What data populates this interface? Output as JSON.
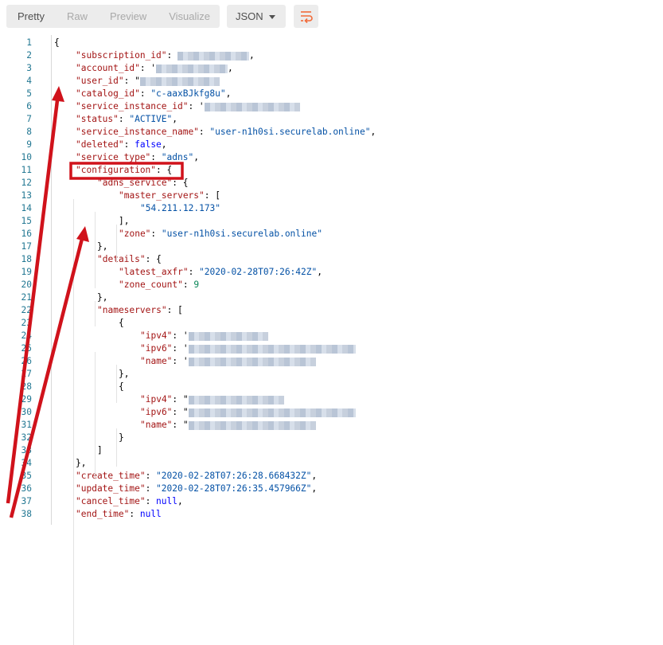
{
  "toolbar": {
    "tabs": [
      "Pretty",
      "Raw",
      "Preview",
      "Visualize"
    ],
    "format": "JSON",
    "wrap_icon": "wrap-lines-icon"
  },
  "code": {
    "lines": [
      [
        [
          "p",
          "{"
        ]
      ],
      [
        [
          "k",
          "\"subscription_id\""
        ],
        [
          "p",
          ": "
        ],
        [
          "R",
          ""
        ],
        [
          "p",
          ","
        ]
      ],
      [
        [
          "k",
          "\"account_id\""
        ],
        [
          "p",
          ": '"
        ],
        [
          "R",
          ""
        ],
        [
          "p",
          ","
        ]
      ],
      [
        [
          "k",
          "\"user_id\""
        ],
        [
          "p",
          ": \""
        ],
        [
          "R",
          ""
        ]
      ],
      [
        [
          "k",
          "\"catalog_id\""
        ],
        [
          "p",
          ": "
        ],
        [
          "s",
          "\"c-aaxBJkfg8u\""
        ],
        [
          "p",
          ","
        ]
      ],
      [
        [
          "k",
          "\"service_instance_id\""
        ],
        [
          "p",
          ": '"
        ],
        [
          "R",
          ""
        ]
      ],
      [
        [
          "k",
          "\"status\""
        ],
        [
          "p",
          ": "
        ],
        [
          "s",
          "\"ACTIVE\""
        ],
        [
          "p",
          ","
        ]
      ],
      [
        [
          "k",
          "\"service_instance_name\""
        ],
        [
          "p",
          ": "
        ],
        [
          "s",
          "\"user-n1h0si.securelab.online\""
        ],
        [
          "p",
          ","
        ]
      ],
      [
        [
          "k",
          "\"deleted\""
        ],
        [
          "p",
          ": "
        ],
        [
          "b",
          "false"
        ],
        [
          "p",
          ","
        ]
      ],
      [
        [
          "k",
          "\"service_type\""
        ],
        [
          "p",
          ": "
        ],
        [
          "s",
          "\"adns\""
        ],
        [
          "p",
          ","
        ]
      ],
      [
        [
          "k",
          "\"configuration\""
        ],
        [
          "p",
          ": {"
        ]
      ],
      [
        [
          "k",
          "\"adns_service\""
        ],
        [
          "p",
          ": {"
        ]
      ],
      [
        [
          "k",
          "\"master_servers\""
        ],
        [
          "p",
          ": ["
        ]
      ],
      [
        [
          "s",
          "\"54.211.12.173\""
        ]
      ],
      [
        [
          "p",
          "],"
        ]
      ],
      [
        [
          "k",
          "\"zone\""
        ],
        [
          "p",
          ": "
        ],
        [
          "s",
          "\"user-n1h0si.securelab.online\""
        ]
      ],
      [
        [
          "p",
          "},"
        ]
      ],
      [
        [
          "k",
          "\"details\""
        ],
        [
          "p",
          ": {"
        ]
      ],
      [
        [
          "k",
          "\"latest_axfr\""
        ],
        [
          "p",
          ": "
        ],
        [
          "s",
          "\"2020-02-28T07:26:42Z\""
        ],
        [
          "p",
          ","
        ]
      ],
      [
        [
          "k",
          "\"zone_count\""
        ],
        [
          "p",
          ": "
        ],
        [
          "n",
          "9"
        ]
      ],
      [
        [
          "p",
          "},"
        ]
      ],
      [
        [
          "k",
          "\"nameservers\""
        ],
        [
          "p",
          ": ["
        ]
      ],
      [
        [
          "p",
          "{"
        ]
      ],
      [
        [
          "k",
          "\"ipv4\""
        ],
        [
          "p",
          ": '"
        ],
        [
          "R",
          ""
        ]
      ],
      [
        [
          "k",
          "\"ipv6\""
        ],
        [
          "p",
          ": '"
        ],
        [
          "R",
          ""
        ]
      ],
      [
        [
          "k",
          "\"name\""
        ],
        [
          "p",
          ": '"
        ],
        [
          "R",
          ""
        ]
      ],
      [
        [
          "p",
          "},"
        ]
      ],
      [
        [
          "p",
          "{"
        ]
      ],
      [
        [
          "k",
          "\"ipv4\""
        ],
        [
          "p",
          ": \""
        ],
        [
          "R",
          ""
        ]
      ],
      [
        [
          "k",
          "\"ipv6\""
        ],
        [
          "p",
          ": \""
        ],
        [
          "R",
          ""
        ]
      ],
      [
        [
          "k",
          "\"name\""
        ],
        [
          "p",
          ": \""
        ],
        [
          "R",
          ""
        ]
      ],
      [
        [
          "p",
          "}"
        ]
      ],
      [
        [
          "p",
          "]"
        ]
      ],
      [
        [
          "p",
          "},"
        ]
      ],
      [
        [
          "k",
          "\"create_time\""
        ],
        [
          "p",
          ": "
        ],
        [
          "s",
          "\"2020-02-28T07:26:28.668432Z\""
        ],
        [
          "p",
          ","
        ]
      ],
      [
        [
          "k",
          "\"update_time\""
        ],
        [
          "p",
          ": "
        ],
        [
          "s",
          "\"2020-02-28T07:26:35.457966Z\""
        ],
        [
          "p",
          ","
        ]
      ],
      [
        [
          "k",
          "\"cancel_time\""
        ],
        [
          "p",
          ": "
        ],
        [
          "b",
          "null"
        ],
        [
          "p",
          ","
        ]
      ],
      [
        [
          "k",
          "\"end_time\""
        ],
        [
          "p",
          ": "
        ],
        [
          "b",
          "null"
        ]
      ]
    ]
  }
}
